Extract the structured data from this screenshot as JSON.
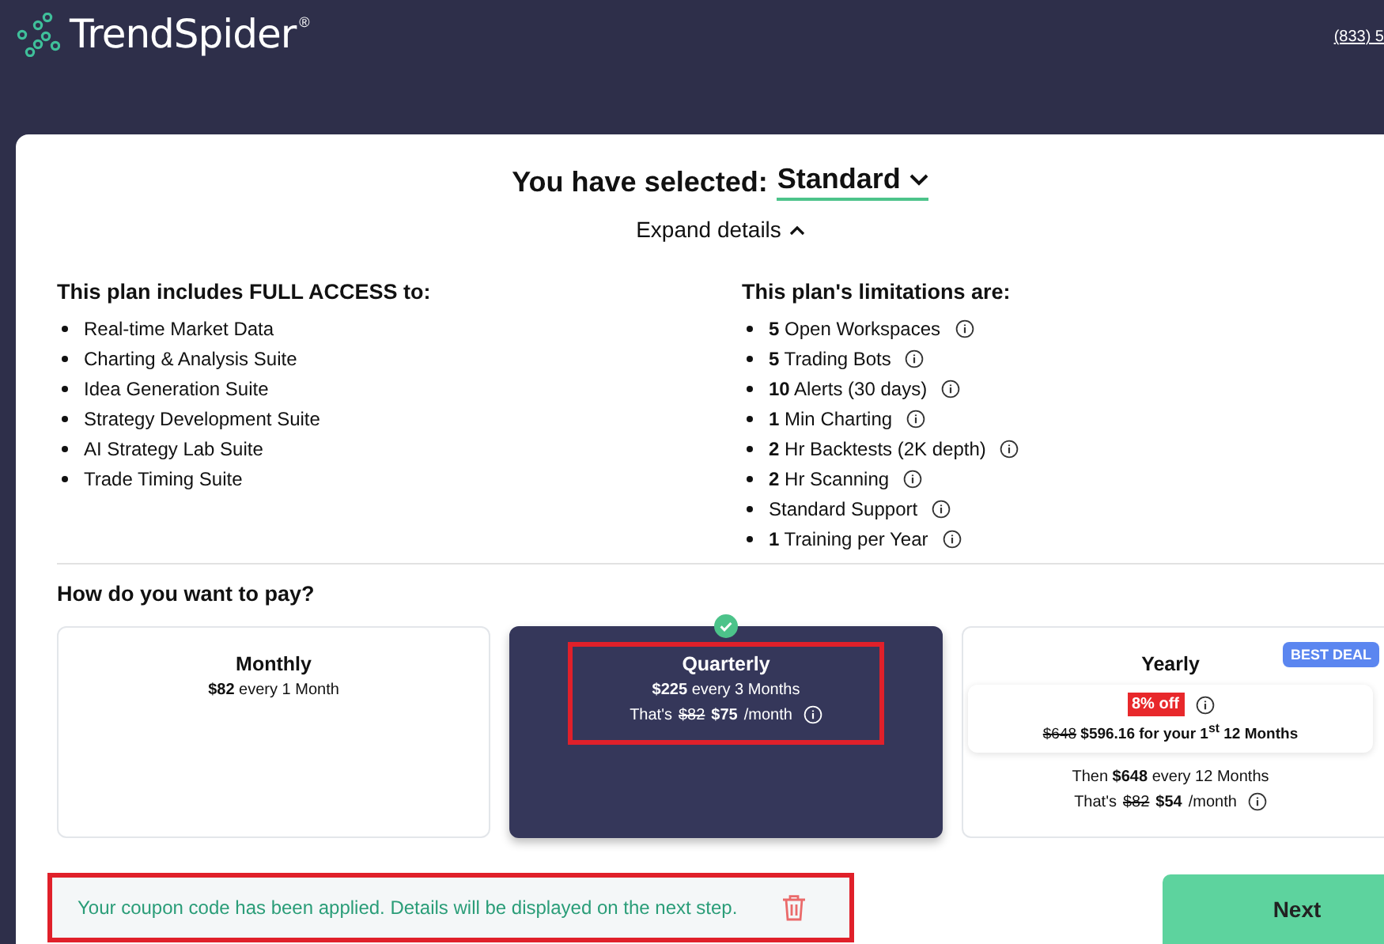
{
  "header": {
    "brand": "TrendSpider",
    "registered": "®",
    "phone": "(833) 5"
  },
  "selection": {
    "label": "You have selected:",
    "plan": "Standard",
    "expand": "Expand details",
    "expanded": true
  },
  "includes": {
    "title": "This plan includes FULL ACCESS to:",
    "items": [
      "Real-time Market Data",
      "Charting & Analysis Suite",
      "Idea Generation Suite",
      "Strategy Development Suite",
      "AI Strategy Lab Suite",
      "Trade Timing Suite"
    ]
  },
  "limitations": {
    "title": "This plan's limitations are:",
    "items": [
      {
        "text": "**5** Open Workspaces"
      },
      {
        "text": "**5** Trading Bots"
      },
      {
        "text": "**10** Alerts (30 days)"
      },
      {
        "text": "**1** Min Charting"
      },
      {
        "text": "**2** Hr Backtests (2K depth)"
      },
      {
        "text": "**2** Hr Scanning"
      },
      {
        "text": "Standard Support"
      },
      {
        "text": "**1** Training per Year"
      }
    ]
  },
  "payment": {
    "title": "How do you want to pay?",
    "options": [
      {
        "name": "Monthly",
        "price": "**$82** every 1 Month",
        "selected": false,
        "highlighted": false
      },
      {
        "name": "Quarterly",
        "price": "**$225** every 3 Months",
        "was": "$82",
        "now": "$75",
        "unit": "/month",
        "prefix": "That's",
        "selected": true,
        "highlighted": true
      },
      {
        "name": "Yearly",
        "badge": "BEST DEAL",
        "discount": "8% off",
        "offer_was": "$648",
        "offer": "**$596.16 for your 1$^{st}$ 12 Months**",
        "then": "Then **$648** every 12 Months",
        "was": "$82",
        "now": "$54",
        "unit": "/month",
        "prefix": "That's",
        "selected": false,
        "highlighted": false
      }
    ]
  },
  "coupon": {
    "message": "Your coupon code has been applied. Details will be displayed on the next step.",
    "highlighted": true
  },
  "next_button": "Next"
}
